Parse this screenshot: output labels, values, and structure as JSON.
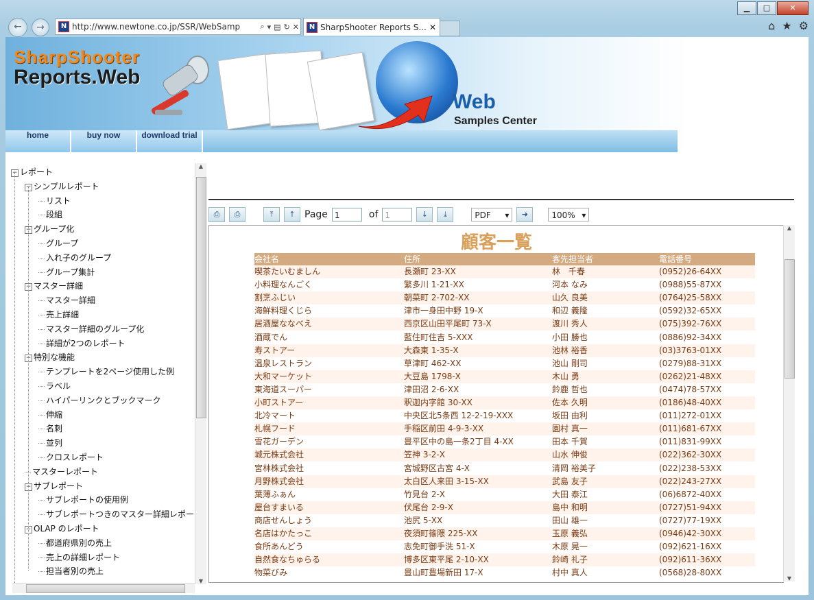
{
  "browser": {
    "url": "http://www.newtone.co.jp/SSR/WebSamp",
    "tab_title": "SharpShooter Reports S...",
    "favicon": "N"
  },
  "banner": {
    "logo_line1": "SharpShooter",
    "logo_line2": "Reports.Web",
    "web": "Web",
    "samples": "Samples Center",
    "menu": [
      "home",
      "buy now",
      "download trial"
    ]
  },
  "tree": [
    {
      "label": "レポート",
      "level": 0,
      "exp": "−"
    },
    {
      "label": "シンプルレポート",
      "level": 1,
      "exp": "−"
    },
    {
      "label": "リスト",
      "level": 2
    },
    {
      "label": "段組",
      "level": 2
    },
    {
      "label": "グループ化",
      "level": 1,
      "exp": "−"
    },
    {
      "label": "グループ",
      "level": 2
    },
    {
      "label": "入れ子のグループ",
      "level": 2
    },
    {
      "label": "グループ集計",
      "level": 2
    },
    {
      "label": "マスター詳細",
      "level": 1,
      "exp": "−"
    },
    {
      "label": "マスター詳細",
      "level": 2
    },
    {
      "label": "売上詳細",
      "level": 2
    },
    {
      "label": "マスター詳細のグループ化",
      "level": 2
    },
    {
      "label": "詳細が2つのレポート",
      "level": 2
    },
    {
      "label": "特別な機能",
      "level": 1,
      "exp": "−"
    },
    {
      "label": "テンプレートを2ページ使用した例",
      "level": 2
    },
    {
      "label": "ラベル",
      "level": 2
    },
    {
      "label": "ハイパーリンクとブックマーク",
      "level": 2
    },
    {
      "label": "伸縮",
      "level": 2
    },
    {
      "label": "名刺",
      "level": 2
    },
    {
      "label": "並列",
      "level": 2
    },
    {
      "label": "クロスレポート",
      "level": 2
    },
    {
      "label": "マスターレポート",
      "level": 1
    },
    {
      "label": "サブレポート",
      "level": 1,
      "exp": "−"
    },
    {
      "label": "サブレポートの使用例",
      "level": 2
    },
    {
      "label": "サブレポートつきのマスター詳細レポート",
      "level": 2
    },
    {
      "label": "OLAP のレポート",
      "level": 1,
      "exp": "−"
    },
    {
      "label": "都道府県別の売上",
      "level": 2
    },
    {
      "label": "売上の詳細レポート",
      "level": 2
    },
    {
      "label": "担当者別の売上",
      "level": 2
    }
  ],
  "toolbar": {
    "page_label": "Page",
    "page_value": "1",
    "of_label": "of",
    "total_pages": "1",
    "export_format": "PDF",
    "zoom": "100%"
  },
  "report": {
    "title": "顧客一覧",
    "columns": [
      "会社名",
      "住所",
      "客先担当者",
      "電話番号"
    ],
    "rows": [
      [
        "喫茶たいむましん",
        "長瀬町 23-XX",
        "林　千春",
        "(0952)26-64XX"
      ],
      [
        "小料理なんごく",
        "繁多川 1-21-XX",
        "河本 なみ",
        "(0988)55-87XX"
      ],
      [
        "割烹ふじい",
        "朝菜町 2-702-XX",
        "山久 良美",
        "(0764)25-58XX"
      ],
      [
        "海鮮料理くじら",
        "津市一身田中野 19-X",
        "和辺 義隆",
        "(0592)32-65XX"
      ],
      [
        "居酒屋ななべえ",
        "西京区山田平尾町 73-X",
        "渡川 秀人",
        "(075)392-76XX"
      ],
      [
        "酒蔵でん",
        "藍住町住吉 5-XXX",
        "小田 勝也",
        "(0886)92-34XX"
      ],
      [
        "寿ストアー",
        "大森東 1-35-X",
        "池林 裕香",
        "(03)3763-01XX"
      ],
      [
        "温泉レストラン",
        "草津町 462-XX",
        "池山 剛司",
        "(0279)88-31XX"
      ],
      [
        "大和マーケット",
        "大豆島 1798-X",
        "木山 勇",
        "(0262)21-48XX"
      ],
      [
        "東海道スーパー",
        "津田沼 2-6-XX",
        "鈴鹿 哲也",
        "(0474)78-57XX"
      ],
      [
        "小町ストアー",
        "釈迦内字館 30-XX",
        "佐本 久明",
        "(0186)48-40XX"
      ],
      [
        "北冷マート",
        "中央区北5条西 12-2-19-XXX",
        "坂田 由利",
        "(011)272-01XX"
      ],
      [
        "札幌フード",
        "手稲区前田 4-9-3-XX",
        "園村 真一",
        "(011)681-67XX"
      ],
      [
        "雪花ガーデン",
        "豊平区中の島一条2丁目 4-XX",
        "田本 千賀",
        "(011)831-99XX"
      ],
      [
        "城元株式会社",
        "笠神 3-2-X",
        "山水 伸俊",
        "(022)362-30XX"
      ],
      [
        "宮林株式会社",
        "宮城野区古宮 4-X",
        "清岡 裕美子",
        "(022)238-53XX"
      ],
      [
        "月野株式会社",
        "太白区人来田 3-15-XX",
        "武島 友子",
        "(022)243-27XX"
      ],
      [
        "葉薄ふぁん",
        "竹見台 2-X",
        "大田 泰江",
        "(06)6872-40XX"
      ],
      [
        "屋台すまいる",
        "伏尾台 2-9-X",
        "島中 和明",
        "(0727)51-94XX"
      ],
      [
        "商店せんしょう",
        "池尻 5-XX",
        "田山 雄一",
        "(0727)77-19XX"
      ],
      [
        "名店はかたっこ",
        "夜須町篠隈 225-XX",
        "玉原 義弘",
        "(0946)42-30XX"
      ],
      [
        "食所あんどう",
        "志免町御手洗 51-X",
        "木原 晃一",
        "(092)621-16XX"
      ],
      [
        "自然食なちゅらる",
        "博多区東平尾 2-10-XX",
        "鈴崎 礼子",
        "(092)611-36XX"
      ],
      [
        "物菜びみ",
        "豊山町豊場新田 17-X",
        "村中 真人",
        "(0568)28-80XX"
      ]
    ]
  }
}
